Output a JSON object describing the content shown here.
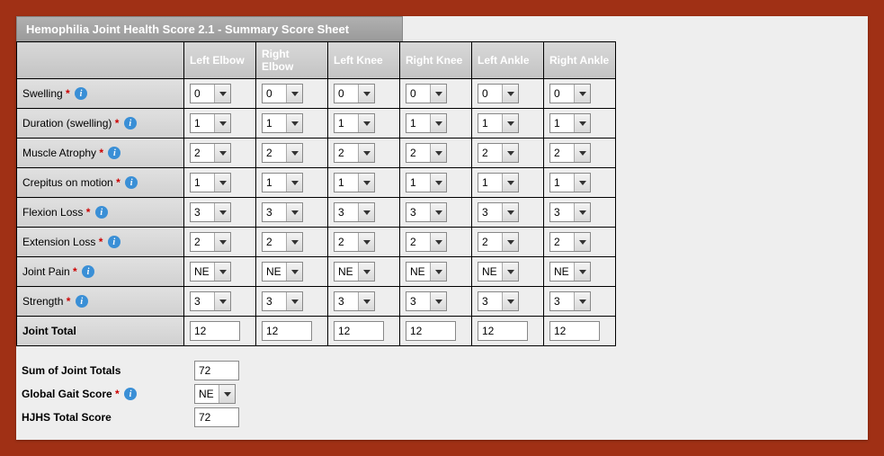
{
  "panel": {
    "title": "Hemophilia Joint Health Score 2.1 - Summary Score Sheet"
  },
  "columns": [
    "Left Elbow",
    "Right Elbow",
    "Left Knee",
    "Right Knee",
    "Left Ankle",
    "Right Ankle"
  ],
  "rows": [
    {
      "label": "Swelling",
      "required": true,
      "info": true,
      "values": [
        "0",
        "0",
        "0",
        "0",
        "0",
        "0"
      ]
    },
    {
      "label": "Duration (swelling)",
      "required": true,
      "info": true,
      "values": [
        "1",
        "1",
        "1",
        "1",
        "1",
        "1"
      ]
    },
    {
      "label": "Muscle Atrophy",
      "required": true,
      "info": true,
      "values": [
        "2",
        "2",
        "2",
        "2",
        "2",
        "2"
      ]
    },
    {
      "label": "Crepitus on motion",
      "required": true,
      "info": true,
      "values": [
        "1",
        "1",
        "1",
        "1",
        "1",
        "1"
      ]
    },
    {
      "label": "Flexion Loss",
      "required": true,
      "info": true,
      "values": [
        "3",
        "3",
        "3",
        "3",
        "3",
        "3"
      ]
    },
    {
      "label": "Extension Loss",
      "required": true,
      "info": true,
      "values": [
        "2",
        "2",
        "2",
        "2",
        "2",
        "2"
      ]
    },
    {
      "label": "Joint Pain",
      "required": true,
      "info": true,
      "values": [
        "NE",
        "NE",
        "NE",
        "NE",
        "NE",
        "NE"
      ]
    },
    {
      "label": "Strength",
      "required": true,
      "info": true,
      "values": [
        "3",
        "3",
        "3",
        "3",
        "3",
        "3"
      ]
    }
  ],
  "jointTotal": {
    "label": "Joint Total",
    "values": [
      "12",
      "12",
      "12",
      "12",
      "12",
      "12"
    ]
  },
  "summary": {
    "sumLabel": "Sum of Joint Totals",
    "sumValue": "72",
    "gaitLabel": "Global Gait Score",
    "gaitRequired": true,
    "gaitInfo": true,
    "gaitValue": "NE",
    "totalLabel": "HJHS Total Score",
    "totalValue": "72"
  },
  "icons": {
    "info_glyph": "i",
    "required_glyph": "*"
  }
}
